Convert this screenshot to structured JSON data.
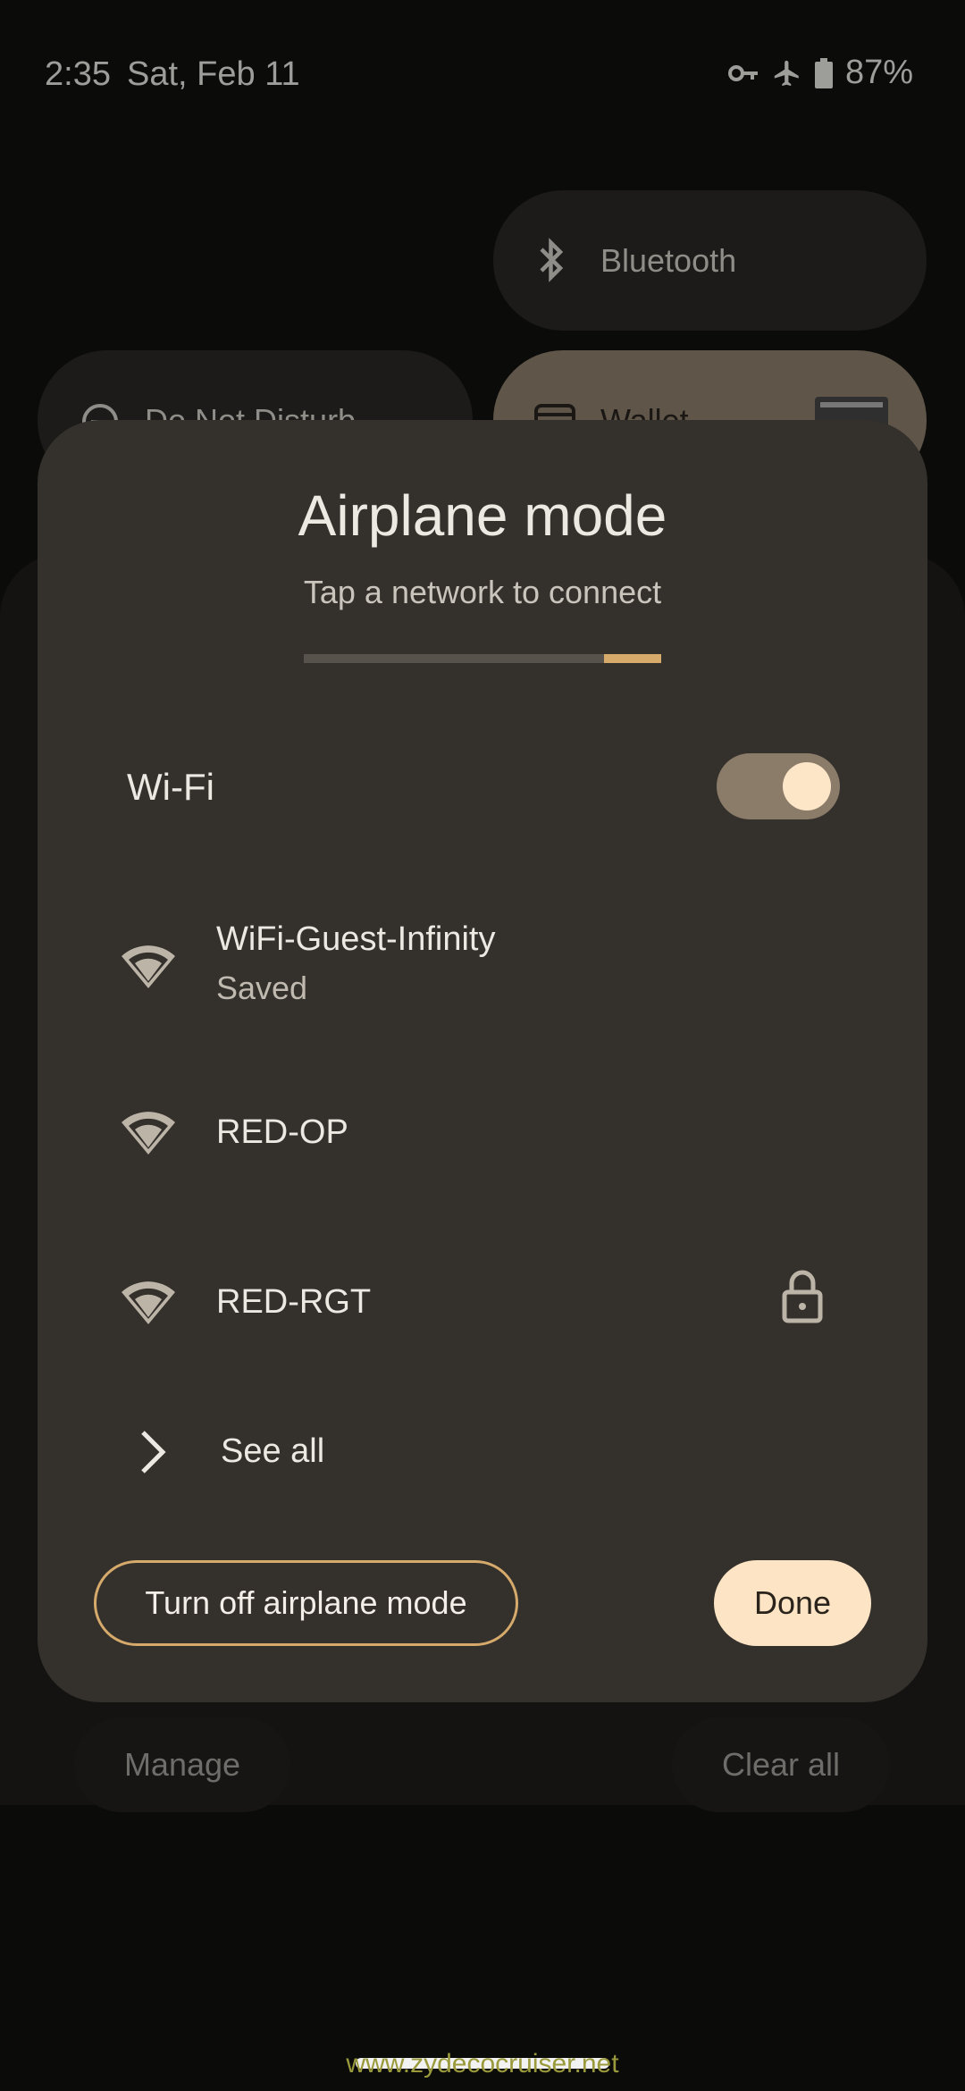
{
  "status_bar": {
    "time": "2:35",
    "date": "Sat, Feb 11",
    "battery": "87%",
    "icons": [
      "vpn-key-icon",
      "airplane-icon",
      "battery-icon"
    ]
  },
  "quick_tiles": {
    "bluetooth": "Bluetooth",
    "dnd": "Do Not Disturb",
    "wallet": "Wallet"
  },
  "dialog": {
    "title": "Airplane mode",
    "subtitle": "Tap a network to connect",
    "progress_fraction_start": 0.84,
    "wifi_label": "Wi-Fi",
    "wifi_enabled": true,
    "networks": [
      {
        "name": "WiFi-Guest-Infinity",
        "status": "Saved",
        "locked": false
      },
      {
        "name": "RED-OP",
        "status": "",
        "locked": false
      },
      {
        "name": "RED-RGT",
        "status": "",
        "locked": true
      }
    ],
    "see_all": "See all",
    "turn_off_button": "Turn off airplane mode",
    "done_button": "Done"
  },
  "background_buttons": {
    "manage": "Manage",
    "clear_all": "Clear all"
  },
  "watermark": "www.zydecocruiser.net",
  "colors": {
    "accent": "#d6aa6b",
    "dialog_bg": "#34302c",
    "done_bg": "#fde4c4"
  }
}
